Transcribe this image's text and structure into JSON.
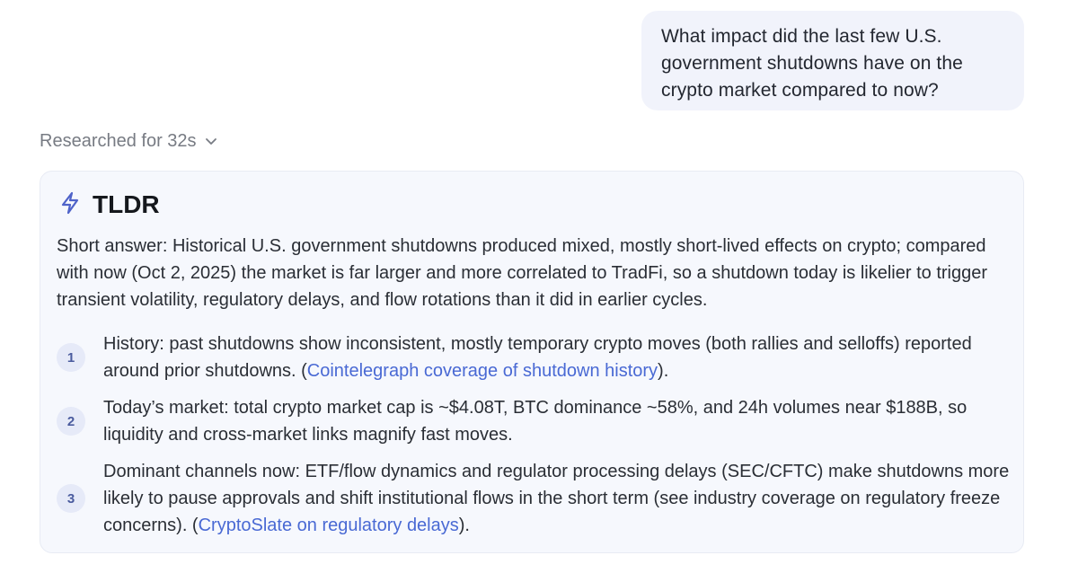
{
  "user_message": {
    "text": "What impact did the last few U.S. government shutdowns have on the crypto market compared to now?"
  },
  "research": {
    "label": "Researched for 32s",
    "toggle_icon": "chevron-down-icon"
  },
  "tldr": {
    "icon": "lightning-bolt-icon",
    "title": "TLDR",
    "summary": "Short answer: Historical U.S. government shutdowns produced mixed, mostly short-lived effects on crypto; compared with now (Oct 2, 2025) the market is far larger and more correlated to TradFi, so a shutdown today is likelier to trigger transient volatility, regulatory delays, and flow rotations than it did in earlier cycles.",
    "items": [
      {
        "number": "1",
        "text_before": "History: past shutdowns show inconsistent, mostly temporary crypto moves (both rallies and selloffs) reported around prior shutdowns. (",
        "link": "Cointelegraph coverage of shutdown history",
        "text_after": ")."
      },
      {
        "number": "2",
        "text_before": "Today’s market: total crypto market cap is ~$4.08T, BTC dominance ~58%, and 24h volumes near $188B, so liquidity and cross-market links magnify fast moves.",
        "link": "",
        "text_after": ""
      },
      {
        "number": "3",
        "text_before": "Dominant channels now: ETF/flow dynamics and regulator processing delays (SEC/CFTC) make shutdowns more likely to pause approvals and shift institutional flows in the short term (see industry coverage on regulatory freeze concerns). (",
        "link": "CryptoSlate on regulatory delays",
        "text_after": ")."
      }
    ]
  },
  "colors": {
    "link": "#4969d4",
    "accent_icon": "#4f63c9",
    "card_bg": "#f6f8fd",
    "bubble_bg": "#f1f3fb"
  }
}
